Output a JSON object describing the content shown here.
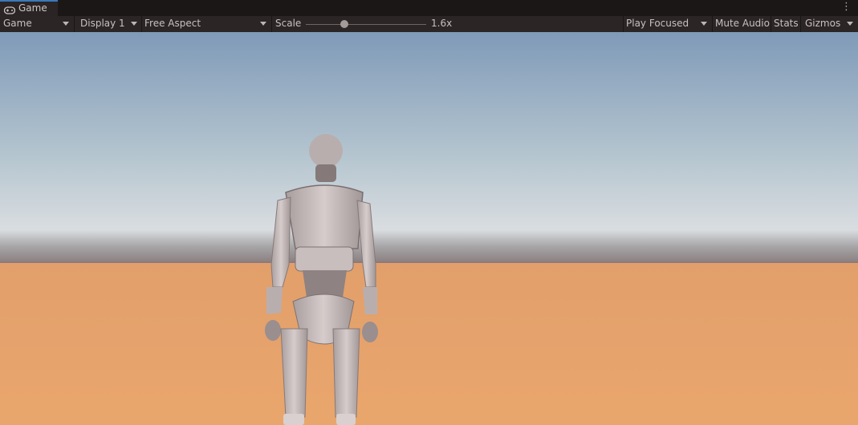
{
  "tab": {
    "title": "Game",
    "icon": "gamepad-icon"
  },
  "menu_icon": "kebab-menu-icon",
  "toolbar": {
    "view_mode": "Game",
    "display": "Display 1",
    "aspect": "Free Aspect",
    "scale_label": "Scale",
    "scale_value": "1.6x",
    "play_mode": "Play Focused",
    "mute_audio": "Mute Audio",
    "stats": "Stats",
    "gizmos": "Gizmos"
  },
  "scale_slider": {
    "min": 1,
    "max": 5,
    "value": 1.6
  },
  "colors": {
    "sky_top": "#7f9ab8",
    "sky_horizon": "#d9dde0",
    "ground": "#e6a46e",
    "accent": "#3a79bb"
  }
}
